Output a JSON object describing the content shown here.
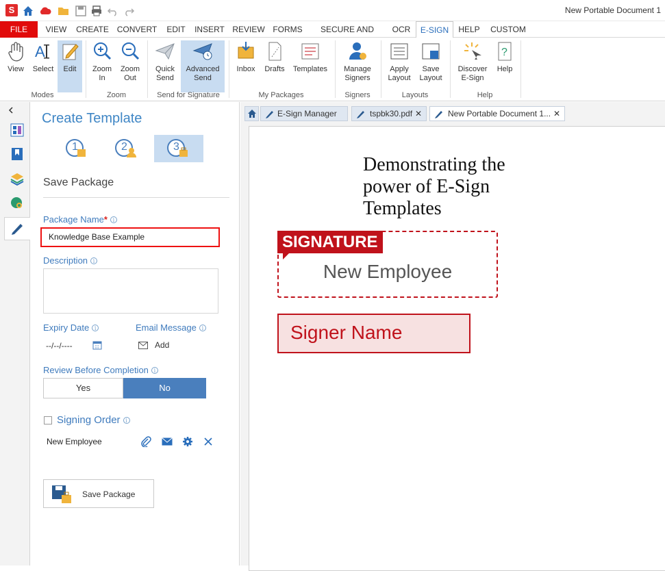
{
  "window": {
    "title": "New Portable Document 1"
  },
  "quick_access": [
    "app-logo",
    "home-icon",
    "cloud-icon",
    "folder-open-icon",
    "save-icon",
    "print-icon",
    "undo-icon",
    "redo-icon"
  ],
  "menu": {
    "tabs": [
      "FILE",
      "VIEW",
      "CREATE",
      "CONVERT",
      "EDIT",
      "INSERT",
      "REVIEW",
      "FORMS",
      "SECURE AND SIGN",
      "OCR",
      "E-SIGN",
      "HELP",
      "CUSTOM"
    ],
    "active": "E-SIGN"
  },
  "ribbon": {
    "view": "View",
    "select": "Select",
    "edit": "Edit",
    "zoom_in": "Zoom In",
    "zoom_out": "Zoom Out",
    "quick_send": "Quick Send",
    "advanced_send": "Advanced Send",
    "inbox": "Inbox",
    "drafts": "Drafts",
    "templates": "Templates",
    "manage_signers": "Manage Signers",
    "apply_layout": "Apply Layout",
    "save_layout": "Save Layout",
    "discover": "Discover E-Sign",
    "help": "Help",
    "groups": {
      "modes": "Modes",
      "zoom": "Zoom",
      "send": "Send for Signature",
      "packages": "My Packages",
      "signers": "Signers",
      "layouts": "Layouts",
      "help": "Help"
    }
  },
  "panel": {
    "title": "Create Template",
    "steps": [
      "1",
      "2",
      "3"
    ],
    "active_step": 3,
    "section": "Save Package",
    "package_name_label": "Package Name",
    "package_name_value": "Knowledge Base Example",
    "description_label": "Description",
    "expiry_label": "Expiry Date",
    "expiry_value": "--/--/----",
    "email_label": "Email Message",
    "email_add": "Add",
    "review_label": "Review Before Completion",
    "review_yes": "Yes",
    "review_no": "No",
    "review_selected": "No",
    "signing_order_label": "Signing Order",
    "signer": "New Employee",
    "save_button": "Save Package"
  },
  "doc_tabs": [
    {
      "label": "E-Sign Manager",
      "closable": false
    },
    {
      "label": "tspbk30.pdf",
      "closable": true
    },
    {
      "label": "New Portable Document 1...",
      "closable": true,
      "active": true
    }
  ],
  "document": {
    "heading": "Demonstrating the power of E-Sign Templates",
    "signature_badge": "SIGNATURE",
    "signature_signer": "New Employee",
    "name_field": "Signer Name"
  },
  "colors": {
    "accent": "#3f86c5",
    "brand_red": "#c0121b",
    "selected": "#c8dcf1"
  }
}
